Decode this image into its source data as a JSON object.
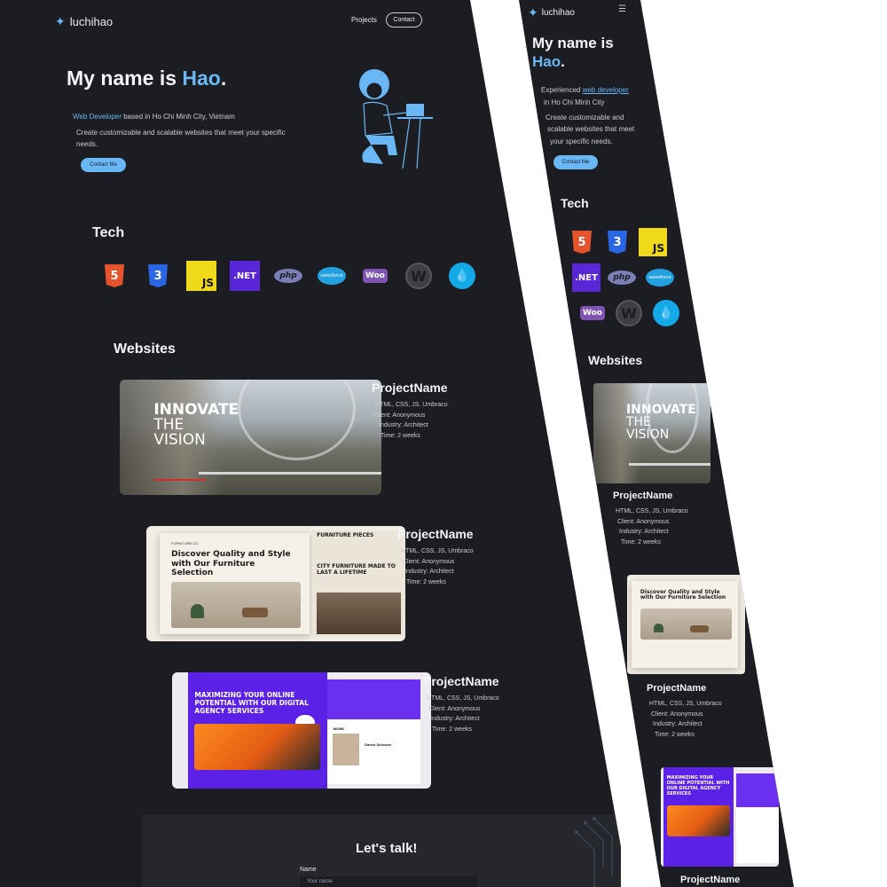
{
  "brand": {
    "name": "luchihao"
  },
  "nav": {
    "projects": "Projects",
    "contact": "Contact"
  },
  "hero": {
    "title_prefix": "My name is ",
    "title_name": "Hao",
    "title_suffix": ".",
    "role": "Web Developer",
    "location_text": " based in Ho Chi Minh City, Vietnam",
    "tagline": "Create customizable and scalable websites that meet your specific needs.",
    "cta": "Contact Me"
  },
  "mobile_hero": {
    "title_line1": "My name is",
    "title_name": "Hao",
    "title_suffix": ".",
    "line_a_prefix": "Experienced ",
    "line_a_link": "web developer",
    "line_b": "in Ho Chi Minh City",
    "line_c": "Create customizable and",
    "line_d": "scalable websites that meet",
    "line_e": "your specific needs."
  },
  "tech": {
    "title": "Tech",
    "items": [
      {
        "name": "HTML5",
        "icon": "html5-icon",
        "glyph": "5"
      },
      {
        "name": "CSS3",
        "icon": "css3-icon",
        "glyph": "3"
      },
      {
        "name": "JavaScript",
        "icon": "javascript-icon",
        "glyph": "JS"
      },
      {
        "name": ".NET",
        "icon": "dotnet-icon",
        "glyph": ".NET"
      },
      {
        "name": "PHP",
        "icon": "php-icon",
        "glyph": "php"
      },
      {
        "name": "Salesforce",
        "icon": "salesforce-icon",
        "glyph": "salesforce"
      },
      {
        "name": "WooCommerce",
        "icon": "woocommerce-icon",
        "glyph": "Woo"
      },
      {
        "name": "WordPress",
        "icon": "wordpress-icon",
        "glyph": "W"
      },
      {
        "name": "Drupal",
        "icon": "drupal-icon",
        "glyph": "💧"
      }
    ]
  },
  "websites": {
    "title": "Websites",
    "projects": [
      {
        "name": "ProjectName",
        "stack": "HTML, CSS, JS, Umbraco",
        "client": "Client: Anonymous",
        "industry": "Industry: Architect",
        "time": "Time: 2 weeks",
        "shot": {
          "line1": "INNOVATE",
          "line2": "THE",
          "line3": "VISION"
        }
      },
      {
        "name": "ProjectName",
        "stack": "HTML, CSS, JS, Umbraco",
        "client": "Client: Anonymous",
        "industry": "Industry: Architect",
        "time": "Time: 2 weeks",
        "shot": {
          "brand": "FURNITURE CO.",
          "headline": "Discover Quality and Style with Our Furniture Selection",
          "side_title": "FURNITURE PIECES",
          "side_title2": "CITY FURNITURE MADE TO LAST A LIFETIME"
        }
      },
      {
        "name": "ProjectName",
        "stack": "HTML, CSS, JS, Umbraco",
        "client": "Client: Anonymous",
        "industry": "Industry: Architect",
        "time": "Time: 2 weeks",
        "shot": {
          "headline": "MAXIMIZING YOUR ONLINE POTENTIAL WITH OUR DIGITAL AGENCY SERVICES",
          "work": "WORK",
          "item": "Dariss Skincare"
        }
      }
    ]
  },
  "contact": {
    "title": "Let's talk!",
    "name_label": "Name",
    "name_placeholder": "Your name"
  },
  "colors": {
    "accent": "#6ab7f5",
    "background": "#1b1d22"
  }
}
